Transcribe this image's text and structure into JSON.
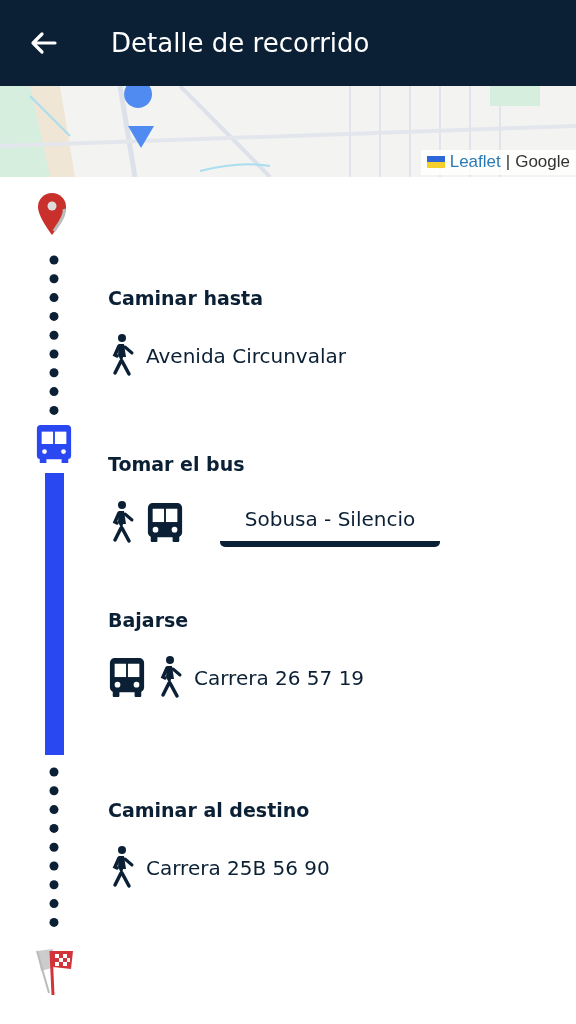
{
  "app_bar": {
    "title": "Detalle de recorrido"
  },
  "map": {
    "kind": "picture",
    "attribution": {
      "link": "Leaflet",
      "separator": "|",
      "provider": "Google"
    }
  },
  "legs": [
    {
      "kind": "walk",
      "steps": [
        {
          "title": "Caminar hasta",
          "icons": [
            {
              "kind": "walk"
            }
          ],
          "place": "Avenida Circunvalar"
        }
      ]
    },
    {
      "kind": "bus",
      "steps": [
        {
          "title": "Tomar el bus",
          "icons": [
            {
              "kind": "walk"
            },
            {
              "kind": "bus"
            }
          ],
          "route": {
            "value": "Sobusa - Silencio"
          }
        },
        {
          "title": "Bajarse",
          "icons": [
            {
              "kind": "bus"
            },
            {
              "kind": "walk"
            }
          ],
          "place": "Carrera 26 57 19"
        }
      ]
    },
    {
      "kind": "walk",
      "steps": [
        {
          "title": "Caminar al destino",
          "icons": [
            {
              "kind": "walk"
            }
          ],
          "place": "Carrera 25B 56 90"
        }
      ]
    }
  ]
}
